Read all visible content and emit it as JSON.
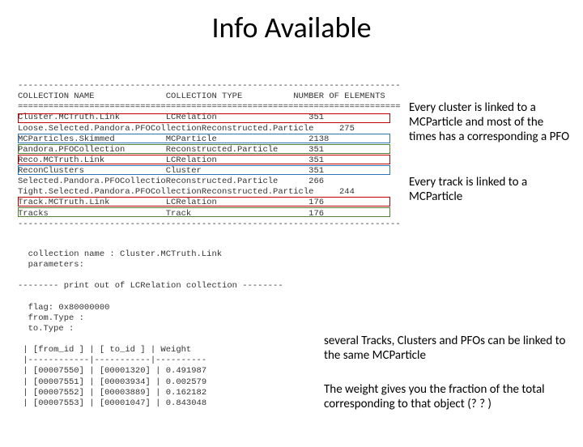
{
  "title": "Info Available",
  "terminal_header": "---------------------------------------------------------------------------\nCOLLECTION NAME              COLLECTION TYPE          NUMBER OF ELEMENTS\n===========================================================================",
  "collections": [
    {
      "name": "Cluster.MCTruth.Link",
      "type": "LCRelation",
      "count": "351"
    },
    {
      "name": "Loose.Selected.Pandora.PFOCollectionReconstructed.Particle",
      "type": "",
      "count": "275"
    },
    {
      "name": "MCParticles.Skimmed",
      "type": "MCParticle",
      "count": "2138"
    },
    {
      "name": "Pandora.PFOCollection",
      "type": "Reconstructed.Particle",
      "count": "351"
    },
    {
      "name": "Reco.MCTruth.Link",
      "type": "LCRelation",
      "count": "351"
    },
    {
      "name": "ReconClusters",
      "type": "Cluster",
      "count": "351"
    },
    {
      "name": "Selected.Pandora.PFOCollection",
      "type": "Reconstructed.Particle",
      "count": "266"
    },
    {
      "name": "Tight.Selected.Pandora.PFOCollectionReconstructed.Particle",
      "type": "",
      "count": "244"
    },
    {
      "name": "Track.MCTruth.Link",
      "type": "LCRelation",
      "count": "176"
    },
    {
      "name": "Tracks",
      "type": "Track",
      "count": "176"
    }
  ],
  "terminal_footer": "---------------------------------------------------------------------------",
  "note_cluster": "Every cluster is linked to a MCParticle and most of the times has a corresponding  a PFO",
  "note_track": "Every track is linked to a MCParticle",
  "terminal2_lines": "  collection name : Cluster.MCTruth.Link\n  parameters:\n\n-------- print out of LCRelation collection --------\n\n  flag: 0x80000000\n  from.Type :\n  to.Type :\n\n | [from_id ] | [ to_id ] | Weight\n |------------|-----------|----------\n | [00007550] | [00001320] | 0.491987\n | [00007551] | [00003934] | 0.002579\n | [00007552] | [00003889] | 0.162182\n | [00007553] | [00001047] | 0.843048",
  "note_links": "several Tracks, Clusters and PFOs can be linked to the same MCParticle",
  "note_weight": "The weight gives you the fraction of the total corresponding to that object (? ? )"
}
